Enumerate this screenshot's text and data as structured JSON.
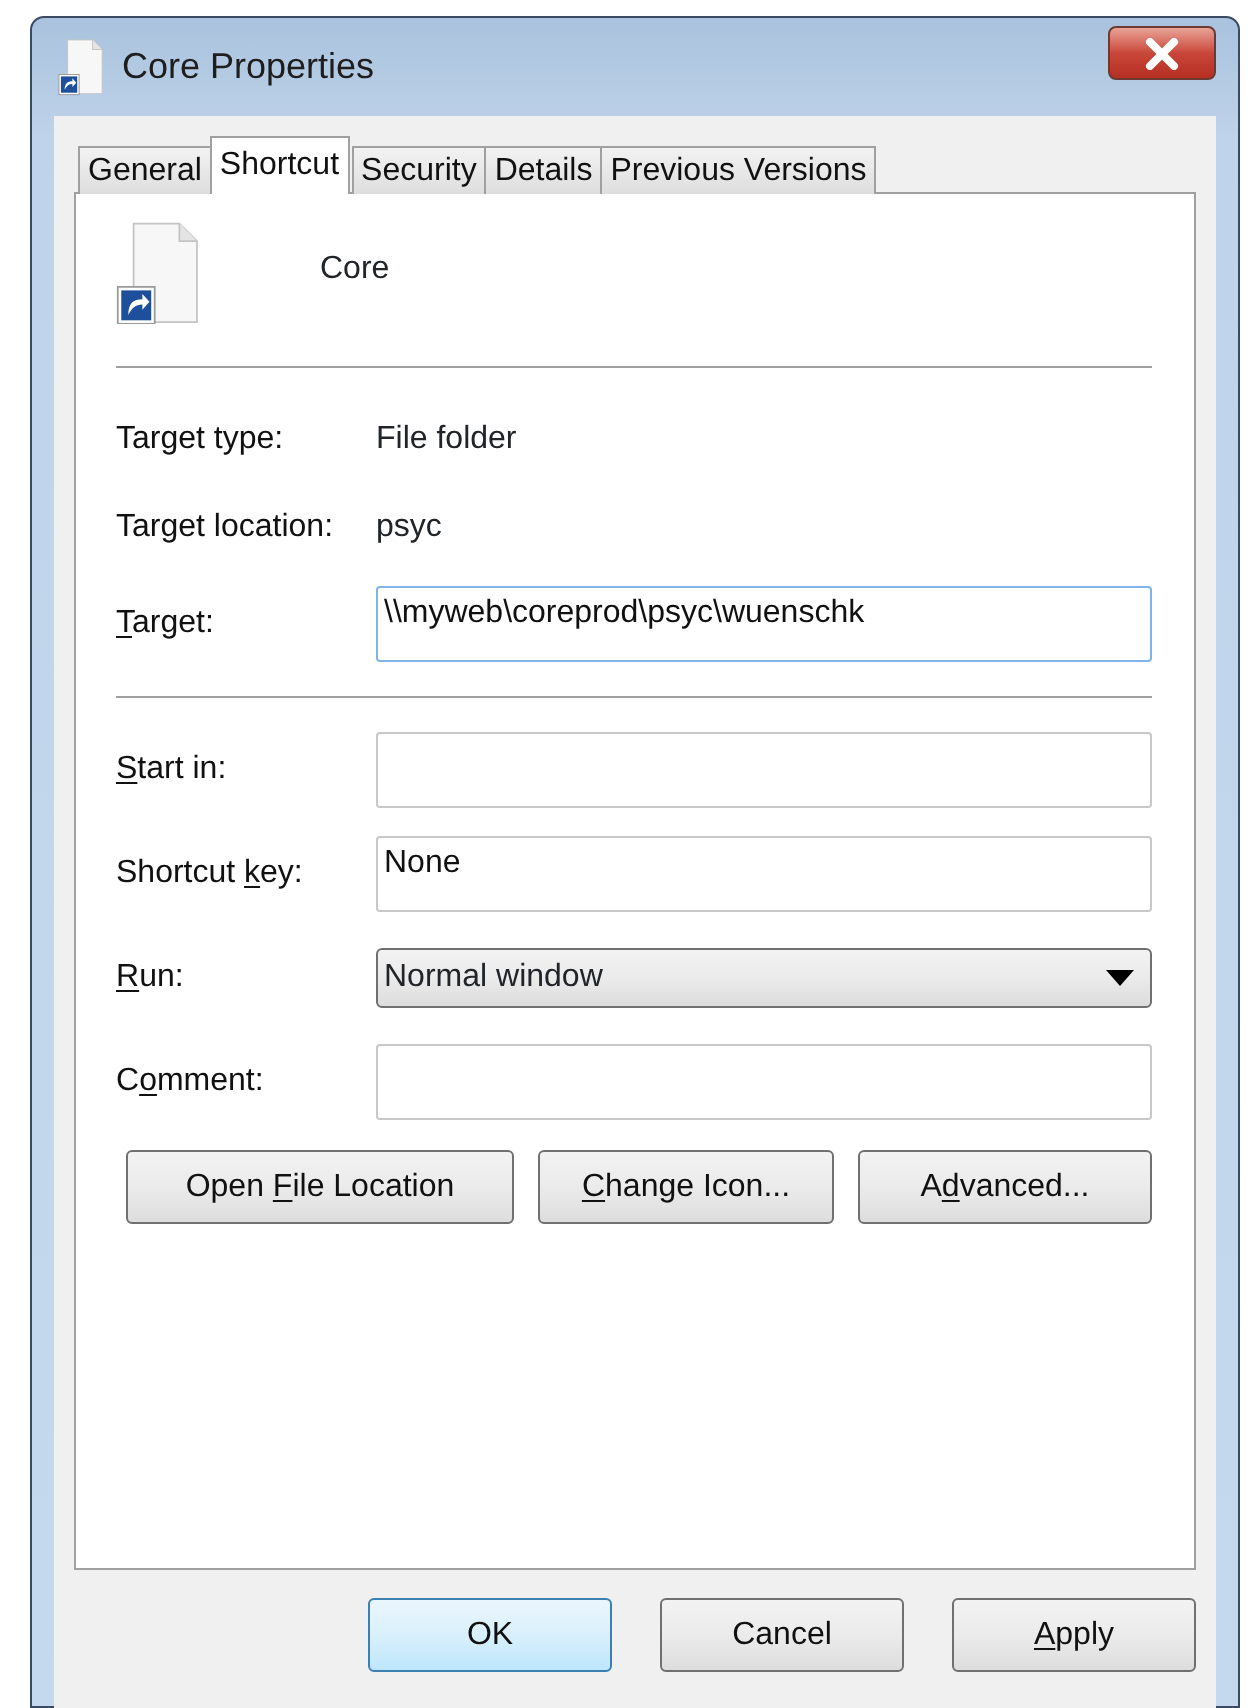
{
  "window": {
    "title": "Core Properties"
  },
  "tabs": [
    {
      "label": "General",
      "selected": false
    },
    {
      "label": "Shortcut",
      "selected": true
    },
    {
      "label": "Security",
      "selected": false
    },
    {
      "label": "Details",
      "selected": false
    },
    {
      "label": "Previous Versions",
      "selected": false
    }
  ],
  "header": {
    "name": "Core"
  },
  "rows": [
    {
      "kind": "text",
      "label": {
        "before": "Target type:"
      },
      "value": "File folder"
    },
    {
      "kind": "text",
      "label": {
        "before": "Target location:"
      },
      "value": "psyc"
    },
    {
      "kind": "field",
      "label": {
        "key": "T",
        "after": "arget:"
      },
      "value": "\\\\myweb\\coreprod\\psyc\\wuenschk",
      "focused": true,
      "divider_after": true
    },
    {
      "kind": "field",
      "label": {
        "key": "S",
        "after": "tart in:"
      },
      "focused": false
    },
    {
      "kind": "field",
      "label": {
        "before": "Shortcut ",
        "key": "k",
        "after": "ey:"
      },
      "value": "None",
      "focused": false
    },
    {
      "kind": "select",
      "label": {
        "key": "R",
        "after": "un:"
      },
      "value": "Normal window"
    },
    {
      "kind": "field",
      "label": {
        "before": "C",
        "key": "o",
        "after": "mment:"
      },
      "focused": false
    }
  ],
  "action_buttons": [
    {
      "before": "Open ",
      "key": "F",
      "after": "ile Location"
    },
    {
      "key": "C",
      "after": "hange Icon..."
    },
    {
      "before": "A",
      "key": "d",
      "after": "vanced..."
    }
  ],
  "dialog_buttons": [
    {
      "before": "OK",
      "default": true
    },
    {
      "before": "Cancel",
      "default": false
    },
    {
      "key": "A",
      "after": "pply",
      "default": false
    }
  ]
}
